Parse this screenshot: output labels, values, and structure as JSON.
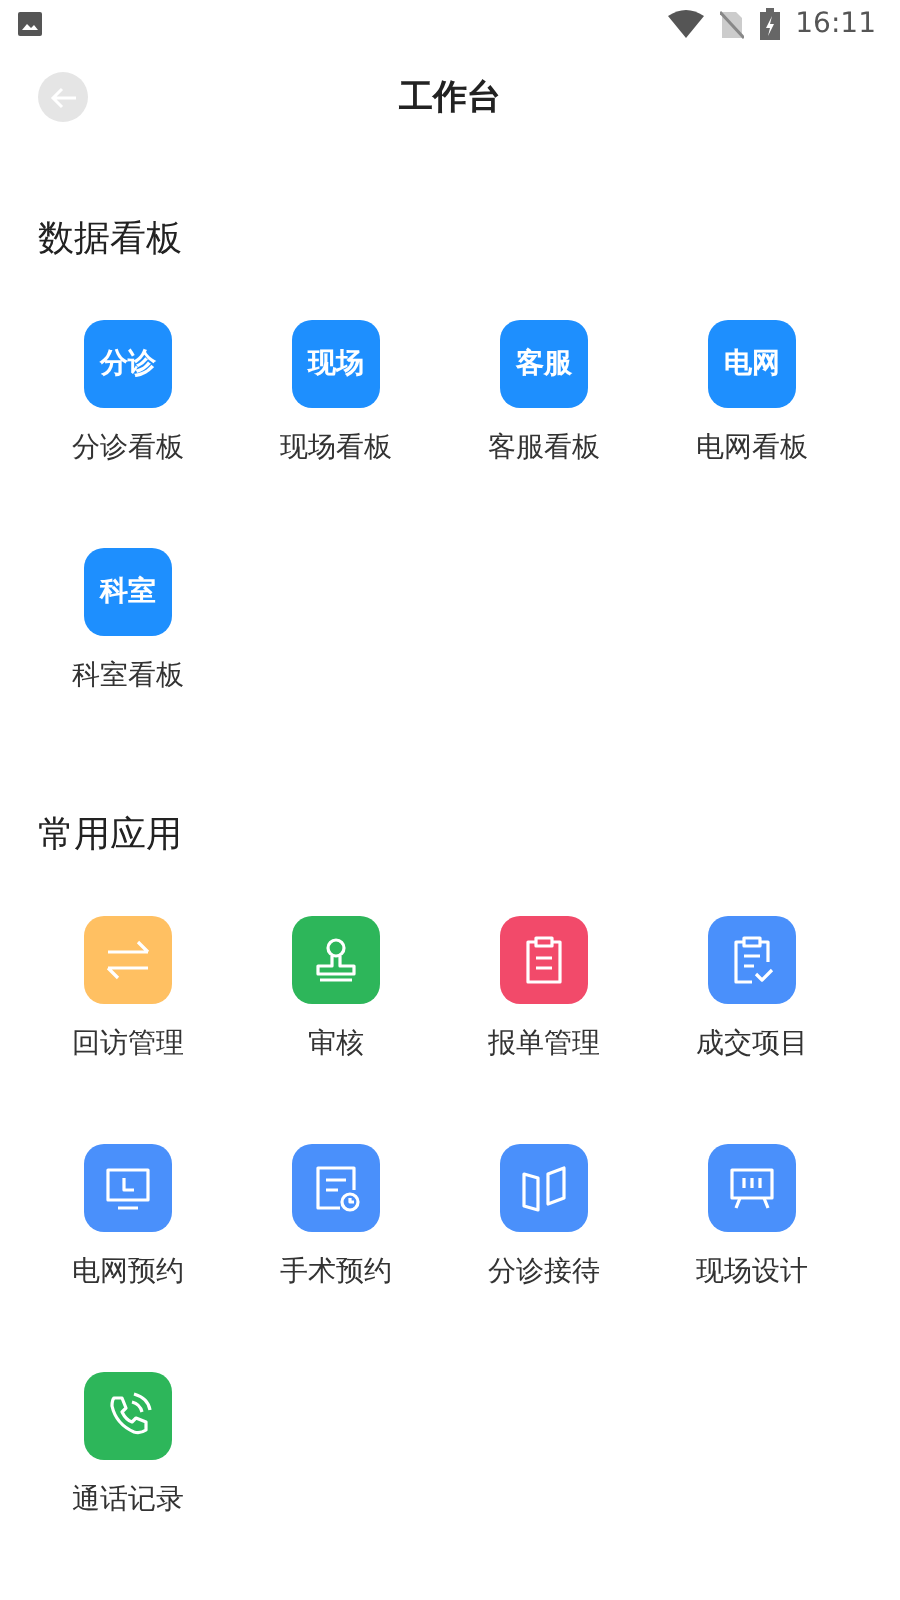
{
  "status_bar": {
    "time": "16:11"
  },
  "header": {
    "title": "工作台"
  },
  "sections": [
    {
      "title": "数据看板",
      "items": [
        {
          "kind": "text",
          "icon_text": "分诊",
          "color": "#1e8ffe",
          "label": "分诊看板"
        },
        {
          "kind": "text",
          "icon_text": "现场",
          "color": "#1e8ffe",
          "label": "现场看板"
        },
        {
          "kind": "text",
          "icon_text": "客服",
          "color": "#1e8ffe",
          "label": "客服看板"
        },
        {
          "kind": "text",
          "icon_text": "电网",
          "color": "#1e8ffe",
          "label": "电网看板"
        },
        {
          "kind": "text",
          "icon_text": "科室",
          "color": "#1e8ffe",
          "label": "科室看板"
        }
      ]
    },
    {
      "title": "常用应用",
      "items": [
        {
          "kind": "swap",
          "color": "#ffc062",
          "label": "回访管理"
        },
        {
          "kind": "stamp",
          "color": "#2db65a",
          "label": "审核"
        },
        {
          "kind": "clipboard",
          "color": "#f24a6a",
          "label": "报单管理"
        },
        {
          "kind": "clipboard-check",
          "color": "#4a90fb",
          "label": "成交项目"
        },
        {
          "kind": "monitor",
          "color": "#4a90fb",
          "label": "电网预约"
        },
        {
          "kind": "doc-clock",
          "color": "#4a90fb",
          "label": "手术预约"
        },
        {
          "kind": "panels",
          "color": "#4a90fb",
          "label": "分诊接待"
        },
        {
          "kind": "easel",
          "color": "#4a90fb",
          "label": "现场设计"
        },
        {
          "kind": "phone",
          "color": "#2db65a",
          "label": "通话记录"
        }
      ]
    }
  ]
}
